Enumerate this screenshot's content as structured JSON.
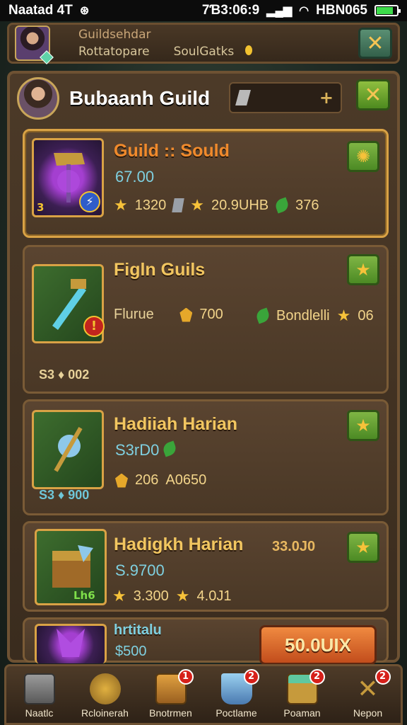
{
  "status_bar": {
    "left_text": "Naatad  4T",
    "right_time": "7Ɓ3:06:9",
    "right_text": "HBN065"
  },
  "top_bar": {
    "line1": "Guildsehdar",
    "line2_left": "Rottatopare",
    "line2_right": "SoulGatks"
  },
  "panel": {
    "guild_title": "Bubaanh Guild",
    "cards": [
      {
        "title": "Guild :: Sould",
        "price": "67.00",
        "corner": "3",
        "stat1": "1320",
        "stat2": "20.9UHB",
        "stat3": "376"
      },
      {
        "title": "Figln Guils",
        "row_label": "Flurue",
        "row_value": "700",
        "row_label2": "Bondlelli",
        "row_value2": "06",
        "bottom": "S3 ♦ 002"
      },
      {
        "title": "Hadiiah Harian",
        "price": "S3rD0",
        "row_value": "206",
        "row_value2": "A0650",
        "bottom": "S3 ♦ 900"
      },
      {
        "title": "Hadigkh Harian",
        "title_right": "33.0J0",
        "price": "S.9700",
        "corner": "Lh6",
        "stat1": "3.300",
        "stat2": "4.0J1"
      },
      {
        "title": "hrtitalu",
        "price": "$500",
        "buy_label": "50.0UIX"
      }
    ]
  },
  "bottom_nav": [
    {
      "label": "Naatlc",
      "badge": ""
    },
    {
      "label": "Rcloinerah",
      "badge": ""
    },
    {
      "label": "Bnotrmen",
      "badge": "1"
    },
    {
      "label": "Poctlame",
      "badge": "2"
    },
    {
      "label": "Poaman",
      "badge": "2"
    },
    {
      "label": "Nepon",
      "badge": "2"
    }
  ]
}
